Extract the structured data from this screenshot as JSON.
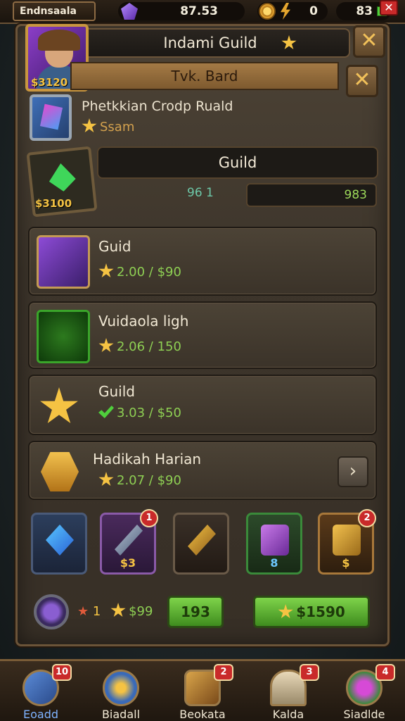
{
  "topbar": {
    "player_name": "Endnsaala",
    "gems": "87.53",
    "gold": "0",
    "energy": "83"
  },
  "header": {
    "avatar_score": "$3120",
    "title": "Indami Guild",
    "ribbon": "Tvk. Bard"
  },
  "section": {
    "title": "Phetkkian Crodp Ruald",
    "subtitle": "Ssam"
  },
  "guild": {
    "label": "Guild",
    "score": "$3100",
    "members": "96 1",
    "progress": "983"
  },
  "list": [
    {
      "name": "Guid",
      "reward": "2.00 / $90",
      "reward_icon": "star-icon",
      "icon": "hero-portrait-icon"
    },
    {
      "name": "Vuidaola ligh",
      "reward": "2.06 / 150",
      "reward_icon": "star-icon",
      "icon": "green-blade-icon"
    },
    {
      "name": "Guild",
      "reward": "3.03 / $50",
      "reward_icon": "check-icon",
      "icon": "gold-star-emblem-icon"
    },
    {
      "name": "Hadikah Harian",
      "reward": "2.07 / $90",
      "reward_icon": "star-icon",
      "icon": "gold-hexagon-icon"
    }
  ],
  "items": [
    {
      "icon": "blue-crystal-icon",
      "count": "",
      "badge": ""
    },
    {
      "icon": "crossbow-icon",
      "count": "$3",
      "badge": "1"
    },
    {
      "icon": "golden-cannon-icon",
      "count": "",
      "badge": ""
    },
    {
      "icon": "purple-chest-icon",
      "count": "8",
      "badge": ""
    },
    {
      "icon": "gold-chest-icon",
      "count": "$",
      "badge": "2"
    }
  ],
  "stats": {
    "count_text": "1",
    "star_value": "$99",
    "button_one": "193",
    "button_two": "$1590"
  },
  "nav": [
    {
      "label": "Eoadd",
      "badge": "10",
      "icon": "cannon-icon"
    },
    {
      "label": "Biadall",
      "badge": "",
      "icon": "spiral-icon"
    },
    {
      "label": "Beokata",
      "badge": "2",
      "icon": "backpack-icon"
    },
    {
      "label": "Kalda",
      "badge": "3",
      "icon": "door-icon"
    },
    {
      "label": "Siadlde",
      "badge": "4",
      "icon": "potion-icon"
    }
  ],
  "colors": {
    "gold": "#f5c343",
    "green_reward": "#8ecf53",
    "panel_brown": "#4d4336",
    "badge_red": "#c92a2a"
  }
}
